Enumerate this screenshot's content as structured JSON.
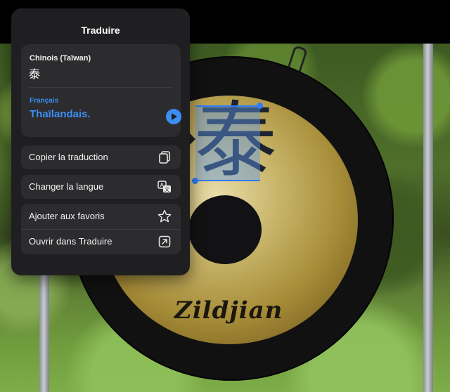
{
  "popover": {
    "title": "Traduire",
    "source_language": "Chinois (Taïwan)",
    "source_text": "泰",
    "target_language": "Français",
    "target_text": "Thaïlandais.",
    "actions": [
      {
        "label": "Copier la traduction",
        "icon": "copy-icon"
      },
      {
        "label": "Changer la langue",
        "icon": "translate-language-icon"
      },
      {
        "label": "Ajouter aux favoris",
        "icon": "star-icon"
      },
      {
        "label": "Ouvrir dans Traduire",
        "icon": "open-external-icon"
      }
    ]
  },
  "photo": {
    "gong_character": "泰",
    "brand": "Zildjian"
  },
  "colors": {
    "accent": "#3b8ff3",
    "panel": "#1f1f21",
    "card": "#2c2c2f",
    "selection": "#2f7cf6"
  }
}
